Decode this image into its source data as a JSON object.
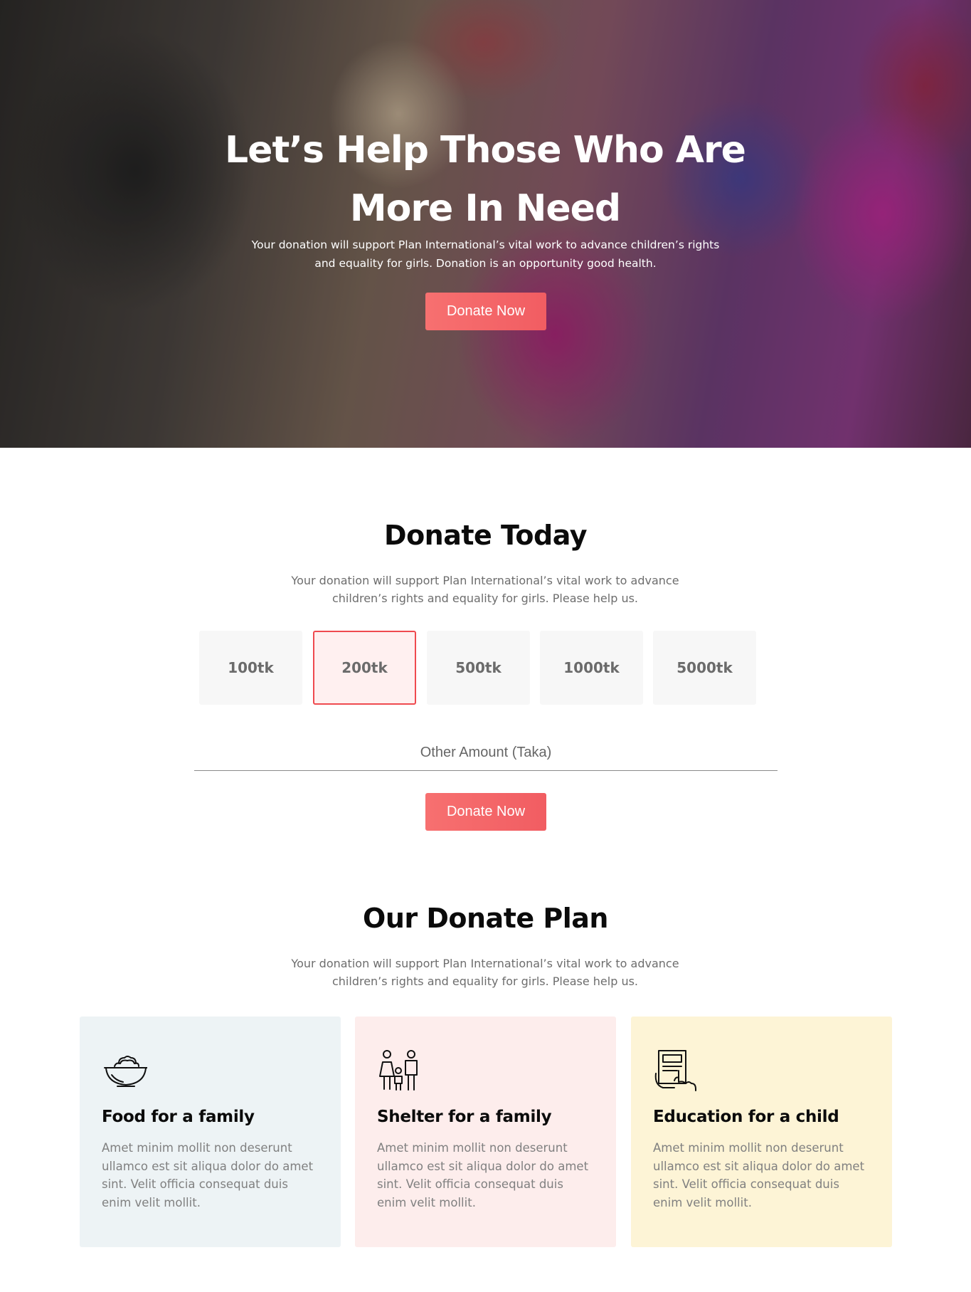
{
  "hero": {
    "title": "Let’s Help Those Who Are More In Need",
    "description": "Your donation will support Plan International’s vital work to advance children’s rights and equality for girls. Donation is an opportunity good health.",
    "button_label": "Donate Now"
  },
  "donate_today": {
    "title": "Donate Today",
    "description": "Your donation will support Plan International’s vital work to advance children’s rights and equality for girls. Please help us.",
    "amounts": [
      "100tk",
      "200tk",
      "500tk",
      "1000tk",
      "5000tk"
    ],
    "selected_amount": "200tk",
    "other_amount_placeholder": "Other Amount (Taka)",
    "button_label": "Donate Now"
  },
  "donate_plan": {
    "title": "Our Donate Plan",
    "description": "Your donation will support Plan International’s vital work to advance children’s rights and equality for girls. Please help us.",
    "cards": [
      {
        "icon": "food-bowl-icon",
        "title": "Food for a family",
        "text": "Amet minim mollit non deserunt ullamco est sit aliqua dolor do amet sint. Velit officia consequat duis enim velit mollit."
      },
      {
        "icon": "family-icon",
        "title": "Shelter for a family",
        "text": "Amet minim mollit non deserunt ullamco est sit aliqua dolor do amet sint. Velit officia consequat duis enim velit mollit."
      },
      {
        "icon": "education-icon",
        "title": "Education for a child",
        "text": "Amet minim mollit non deserunt ullamco est sit aliqua dolor do amet sint. Velit officia consequat duis enim velit mollit."
      }
    ]
  },
  "colors": {
    "accent": "#f15d62",
    "selected_border": "#ef4a4f",
    "card_food_bg": "#edf3f5",
    "card_shelter_bg": "#fdedec",
    "card_education_bg": "#fdf4d6"
  }
}
